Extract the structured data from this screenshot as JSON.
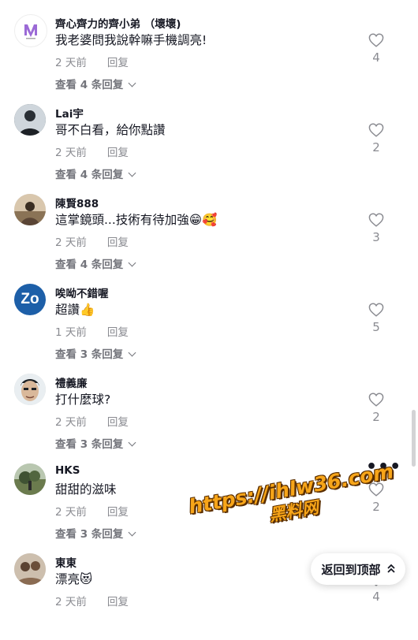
{
  "comments": [
    {
      "name": "齊心齊力的齊小弟 （壞壞)",
      "text": "我老婆問我說幹嘛手機調亮!",
      "time": "2 天前",
      "reply": "回复",
      "more": "查看 4 条回复",
      "likes": "4",
      "avatar_icon": "brand-logo-avatar",
      "avatar_color": "#ffffff"
    },
    {
      "name": "Lai宇",
      "text": "哥不白看，給你點讚",
      "time": "2 天前",
      "reply": "回复",
      "more": "查看 4 条回复",
      "likes": "2",
      "avatar_icon": "person-photo-avatar",
      "avatar_color": "#4a5560"
    },
    {
      "name": "陳賢888",
      "text": "這掌鏡頭...技術有待加強😁🥰",
      "time": "2 天前",
      "reply": "回复",
      "more": "查看 4 条回复",
      "likes": "3",
      "avatar_icon": "person-photo-avatar",
      "avatar_color": "#b59a7c"
    },
    {
      "name": "唉呦不錯喔",
      "text": "超讚👍",
      "time": "1 天前",
      "reply": "回复",
      "more": "查看 3 条回复",
      "likes": "5",
      "avatar_icon": "initials-avatar",
      "avatar_initials": "Zo",
      "avatar_color": "#1d5fa8"
    },
    {
      "name": "禮義廉",
      "text": "打什麼球?",
      "time": "2 天前",
      "reply": "回复",
      "more": "查看 3 条回复",
      "likes": "2",
      "avatar_icon": "cartoon-face-avatar",
      "avatar_color": "#8c9aa3"
    },
    {
      "name": "HKS",
      "text": "甜甜的滋味",
      "time": "2 天前",
      "reply": "回复",
      "more": "查看 3 条回复",
      "likes": "2",
      "avatar_icon": "landscape-photo-avatar",
      "avatar_color": "#5d6e4a"
    },
    {
      "name": "東東",
      "text": "漂亮😻",
      "time": "2 天前",
      "reply": "回复",
      "more": "",
      "likes": "4",
      "avatar_icon": "person-photo-avatar",
      "avatar_color": "#a58a6a"
    }
  ],
  "more_options_icon": "more-horizontal-icon",
  "back_to_top": {
    "label": "返回到顶部",
    "icon": "double-chevron-up-icon"
  },
  "watermark": {
    "line1": "https://ihlw36.com",
    "line2": "黑料网"
  }
}
